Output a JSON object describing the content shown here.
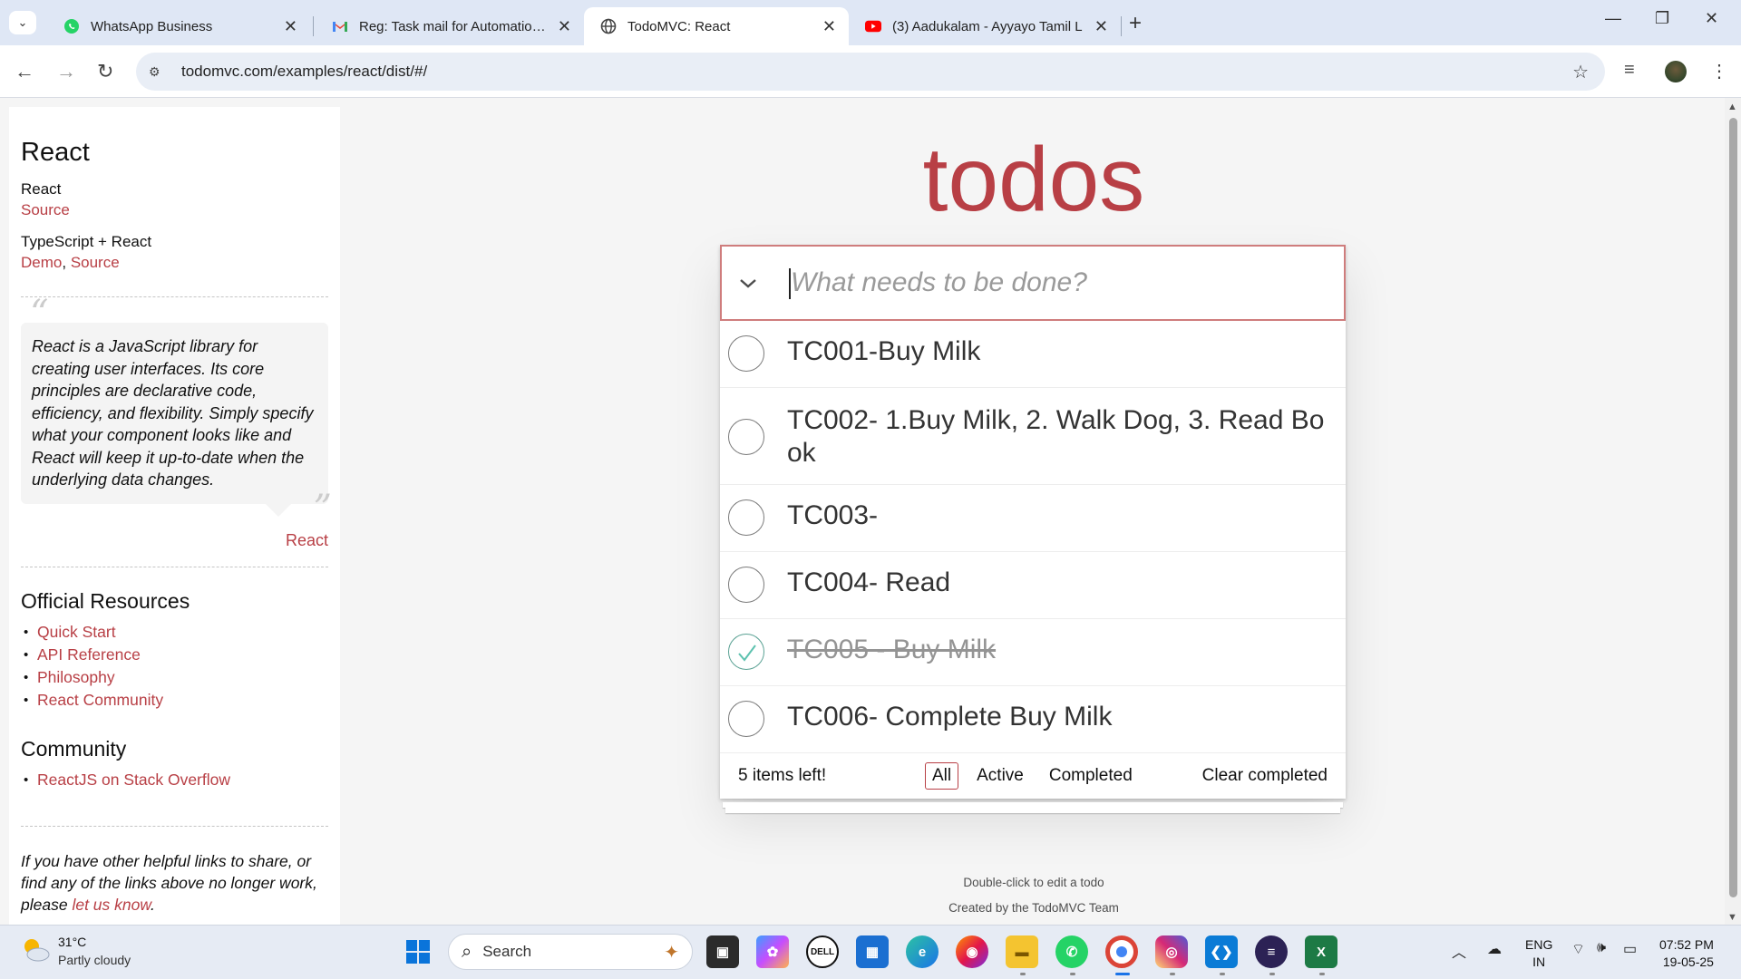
{
  "browser": {
    "tabs": [
      {
        "title": "WhatsApp Business",
        "icon": "whatsapp-icon",
        "color": "#25d366"
      },
      {
        "title": "Reg: Task mail for Automation T",
        "icon": "gmail-icon",
        "color": "#ea4335"
      },
      {
        "title": "TodoMVC: React",
        "icon": "globe-icon",
        "color": "#444444",
        "active": true
      },
      {
        "title": "(3) Aadukalam - Ayyayo Tamil L",
        "icon": "youtube-icon",
        "color": "#ff0000"
      }
    ],
    "url": "todomvc.com/examples/react/dist/#/"
  },
  "sidebar": {
    "heading": "React",
    "examples": [
      {
        "name": "React",
        "links": [
          "Source"
        ]
      },
      {
        "name": "TypeScript + React",
        "links": [
          "Demo",
          "Source"
        ]
      }
    ],
    "quote": "React is a JavaScript library for creating user interfaces. Its core principles are declarative code, efficiency, and flexibility. Simply specify what your component looks like and React will keep it up-to-date when the underlying data changes.",
    "quote_source": "React",
    "resources_title": "Official Resources",
    "resources": [
      "Quick Start",
      "API Reference",
      "Philosophy",
      "React Community"
    ],
    "community_title": "Community",
    "community": [
      "ReactJS on Stack Overflow"
    ],
    "footer_text": "If you have other helpful links to share, or find any of the links above no longer work, please",
    "footer_link": "let us know",
    "footer_end": "."
  },
  "app": {
    "title": "todos",
    "placeholder": "What needs to be done?",
    "todos": [
      {
        "text": "TC001-Buy Milk",
        "completed": false
      },
      {
        "text": "TC002- 1.Buy Milk, 2. Walk Dog, 3. Read Book",
        "completed": false
      },
      {
        "text": "TC003-",
        "completed": false
      },
      {
        "text": "TC004- Read",
        "completed": false
      },
      {
        "text": "TC005 - Buy Milk",
        "completed": true
      },
      {
        "text": "TC006- Complete Buy Milk",
        "completed": false
      }
    ],
    "items_left": "5 items left!",
    "filters": [
      "All",
      "Active",
      "Completed"
    ],
    "selected_filter": "All",
    "clear_completed": "Clear completed",
    "info_edit": "Double-click to edit a todo",
    "info_credit": "Created by the TodoMVC Team",
    "accent_color": "#b83f45"
  },
  "taskbar": {
    "weather_temp": "31°C",
    "weather_desc": "Partly cloudy",
    "search_label": "Search",
    "lang_top": "ENG",
    "lang_bottom": "IN",
    "time": "07:52 PM",
    "date": "19-05-25"
  }
}
